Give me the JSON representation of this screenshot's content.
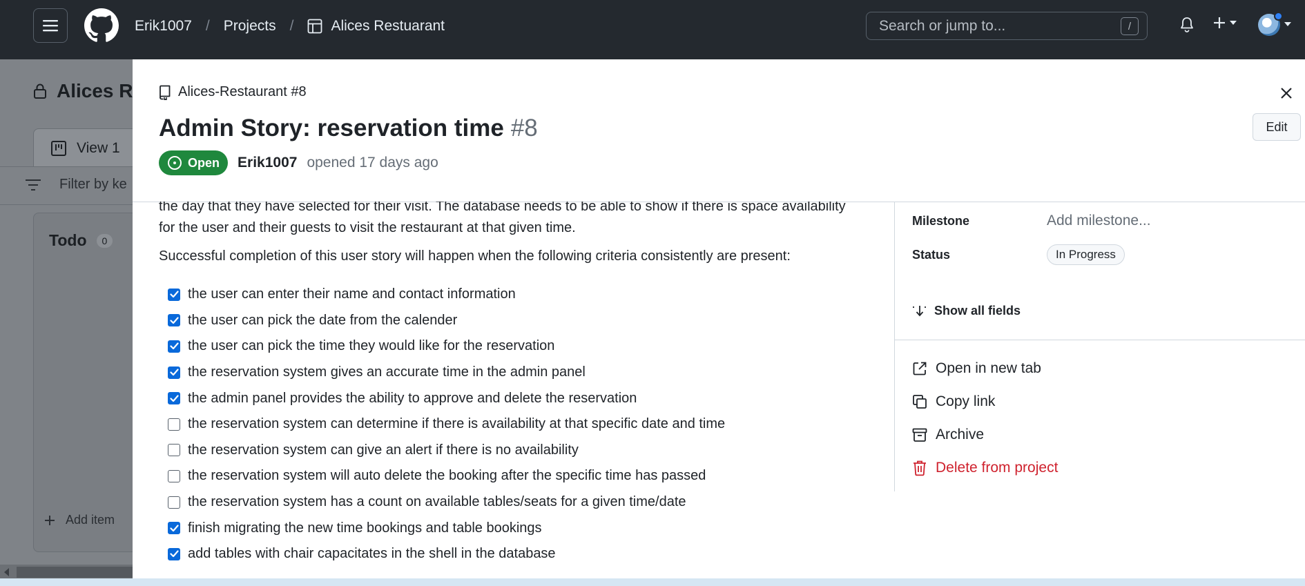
{
  "header": {
    "owner": "Erik1007",
    "section": "Projects",
    "project": "Alices Restuarant",
    "search_placeholder": "Search or jump to...",
    "search_shortcut": "/"
  },
  "board": {
    "title": "Alices Re",
    "view_tab": "View 1",
    "filter_placeholder": "Filter by ke",
    "column_title": "Todo",
    "column_count": "0",
    "add_item": "Add item"
  },
  "panel": {
    "repo_ref": "Alices-Restaurant #8",
    "title": "Admin Story: reservation time",
    "number": "#8",
    "state": "Open",
    "author": "Erik1007",
    "opened_text": "opened 17 days ago",
    "edit_label": "Edit",
    "body_p1": "the day that they have selected for their visit. The database needs to be able to show if there is space availability for the user and their guests to visit the restaurant at that given time.",
    "body_p2": "Successful completion of this user story will happen when the following criteria consistently are present:",
    "tasks": [
      {
        "text": "the user can enter their name and contact information",
        "checked": true
      },
      {
        "text": "the user can pick the date from the calender",
        "checked": true
      },
      {
        "text": "the user can pick the time they would like for the reservation",
        "checked": true
      },
      {
        "text": "the reservation system gives an accurate time in the admin panel",
        "checked": true
      },
      {
        "text": "the admin panel provides the ability to approve and delete the reservation",
        "checked": true
      },
      {
        "text": "the reservation system can determine if there is availability at that specific date and time",
        "checked": false
      },
      {
        "text": "the reservation system can give an alert if there is no availability",
        "checked": false
      },
      {
        "text": "the reservation system will auto delete the booking after the specific time has passed",
        "checked": false
      },
      {
        "text": "the reservation system has a count on available tables/seats for a given time/date",
        "checked": false
      },
      {
        "text": "finish migrating the new time bookings and table bookings",
        "checked": true
      },
      {
        "text": "add tables with chair capacitates in the shell in the database",
        "checked": true
      }
    ],
    "fields": {
      "milestone_label": "Milestone",
      "milestone_value": "Add milestone...",
      "status_label": "Status",
      "status_value": "In Progress",
      "show_all": "Show all fields"
    },
    "actions": {
      "open_new_tab": "Open in new tab",
      "copy_link": "Copy link",
      "archive": "Archive",
      "delete": "Delete from project"
    }
  },
  "colors": {
    "header_bg": "#24292f",
    "open_green": "#1f883d",
    "checkbox_blue": "#0969da",
    "danger_red": "#cf222e"
  }
}
